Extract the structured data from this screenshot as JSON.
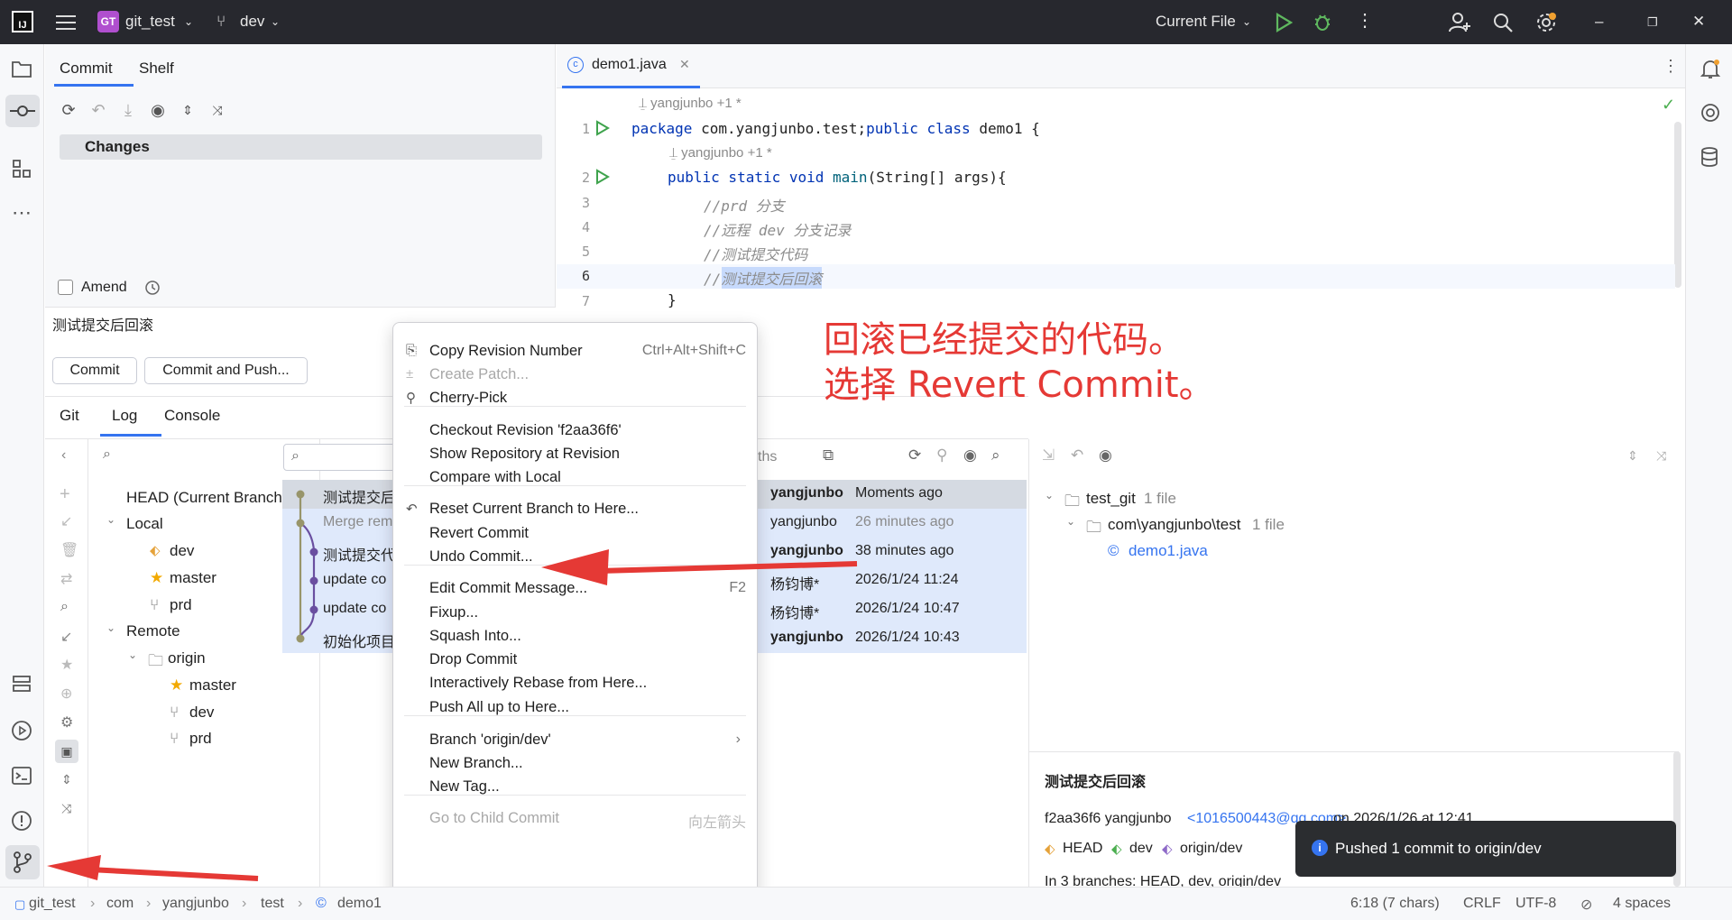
{
  "titlebar": {
    "app_badge": "IJ",
    "project_badge": "GT",
    "project": "git_test",
    "branch": "dev",
    "run_config": "Current File"
  },
  "commit_panel": {
    "tabs": [
      "Commit",
      "Shelf"
    ],
    "changes_label": "Changes",
    "amend_label": "Amend",
    "message": "测试提交后回滚",
    "commit_btn": "Commit",
    "commit_push_btn": "Commit and Push..."
  },
  "git_panel": {
    "tabs": [
      "Git",
      "Log",
      "Console"
    ],
    "branches": {
      "head": "HEAD (Current Branch)",
      "local_label": "Local",
      "local": [
        "dev",
        "master",
        "prd"
      ],
      "remote_label": "Remote",
      "origin_label": "origin",
      "remote": [
        "master",
        "dev",
        "prd"
      ]
    },
    "paths_label": "ths",
    "log": [
      {
        "subject": "测试提交后",
        "author": "yangjunbo",
        "date": "Moments ago",
        "bold": true,
        "sel": true
      },
      {
        "subject": "Merge rem",
        "author": "yangjunbo",
        "date": "26 minutes ago",
        "bold": false,
        "sel": true
      },
      {
        "subject": "测试提交代",
        "author": "yangjunbo",
        "date": "38 minutes ago",
        "bold": true,
        "sel": true
      },
      {
        "subject": "update co",
        "author": "杨钧博*",
        "date": "2026/1/24 11:24",
        "bold": false,
        "sel": true
      },
      {
        "subject": "update co",
        "author": "杨钧博*",
        "date": "2026/1/24 10:47",
        "bold": false,
        "sel": true
      },
      {
        "subject": "初始化项目",
        "author": "yangjunbo",
        "date": "2026/1/24 10:43",
        "bold": true,
        "sel": true
      }
    ],
    "details": {
      "root": "test_git",
      "root_count": "1 file",
      "pkg": "com\\yangjunbo\\test",
      "pkg_count": "1 file",
      "file": "demo1.java",
      "commit_msg": "测试提交后回滚",
      "hash_line_hash": "f2aa36f6 yangjunbo",
      "hash_line_email": "<1016500443@qq.com>",
      "hash_line_date": "on 2026/1/26 at 12:41",
      "refs": [
        "HEAD",
        "dev",
        "origin/dev"
      ],
      "branches_line": "In 3 branches: HEAD, dev, origin/dev"
    }
  },
  "editor": {
    "tab": "demo1.java",
    "author_hint_1": "yangjunbo +1 *",
    "author_hint_2": "yangjunbo +1 *",
    "lines": [
      {
        "n": "1",
        "code": "package com.yangjunbo.test;public class demo1 {"
      },
      {
        "n": "2",
        "code": "public static void main(String[] args){"
      },
      {
        "n": "3",
        "code": "//prd 分支"
      },
      {
        "n": "4",
        "code": "//远程 dev 分支记录"
      },
      {
        "n": "5",
        "code": "//测试提交代码"
      },
      {
        "n": "6",
        "code": "//测试提交后回滚"
      },
      {
        "n": "7",
        "code": "}"
      }
    ]
  },
  "context_menu": {
    "items": [
      {
        "label": "Copy Revision Number",
        "shortcut": "Ctrl+Alt+Shift+C",
        "disabled": false
      },
      {
        "label": "Create Patch...",
        "shortcut": "",
        "disabled": true
      },
      {
        "label": "Cherry-Pick",
        "shortcut": "",
        "disabled": false
      },
      {
        "label": "Checkout Revision 'f2aa36f6'",
        "shortcut": "",
        "disabled": false
      },
      {
        "label": "Show Repository at Revision",
        "shortcut": "",
        "disabled": false
      },
      {
        "label": "Compare with Local",
        "shortcut": "",
        "disabled": false
      },
      {
        "label": "Reset Current Branch to Here...",
        "shortcut": "",
        "disabled": false
      },
      {
        "label": "Revert Commit",
        "shortcut": "",
        "disabled": false
      },
      {
        "label": "Undo Commit...",
        "shortcut": "",
        "disabled": false
      },
      {
        "label": "Edit Commit Message...",
        "shortcut": "F2",
        "disabled": false
      },
      {
        "label": "Fixup...",
        "shortcut": "",
        "disabled": false
      },
      {
        "label": "Squash Into...",
        "shortcut": "",
        "disabled": false
      },
      {
        "label": "Drop Commit",
        "shortcut": "",
        "disabled": false
      },
      {
        "label": "Interactively Rebase from Here...",
        "shortcut": "",
        "disabled": false
      },
      {
        "label": "Push All up to Here...",
        "shortcut": "",
        "disabled": false
      },
      {
        "label": "Branch 'origin/dev'",
        "shortcut": "",
        "disabled": false
      },
      {
        "label": "New Branch...",
        "shortcut": "",
        "disabled": false
      },
      {
        "label": "New Tag...",
        "shortcut": "",
        "disabled": false
      },
      {
        "label": "Go to Child Commit",
        "shortcut": "向左箭头",
        "disabled": true
      }
    ]
  },
  "annotation": {
    "line1": "回滚已经提交的代码。",
    "line2": "选择 Revert Commit。",
    "color": "#e53935"
  },
  "notification": "Pushed 1 commit to origin/dev",
  "statusbar": {
    "crumbs": [
      "git_test",
      "com",
      "yangjunbo",
      "test",
      "demo1"
    ],
    "position": "6:18 (7 chars)",
    "line_sep": "CRLF",
    "encoding": "UTF-8",
    "indent": "4 spaces"
  }
}
